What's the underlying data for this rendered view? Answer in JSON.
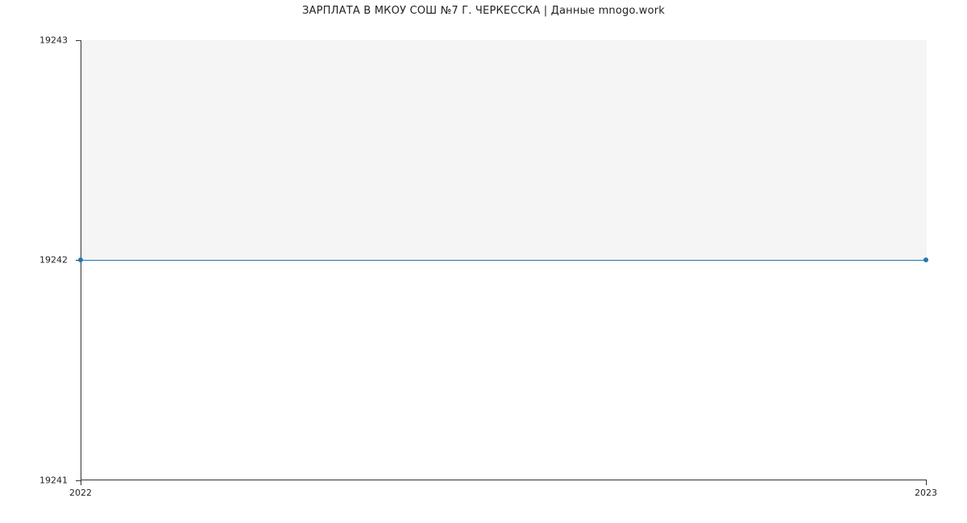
{
  "chart_data": {
    "type": "line",
    "title": "ЗАРПЛАТА В МКОУ СОШ №7 Г. ЧЕРКЕССКА | Данные mnogo.work",
    "xlabel": "",
    "ylabel": "",
    "x_ticks": [
      "2022",
      "2023"
    ],
    "y_ticks": [
      19241,
      19242,
      19243
    ],
    "xlim": [
      "2022",
      "2023"
    ],
    "ylim": [
      19241,
      19243
    ],
    "series": [
      {
        "name": "salary",
        "x": [
          "2022",
          "2023"
        ],
        "y": [
          19242,
          19242
        ],
        "color": "#1f77b4"
      }
    ]
  }
}
